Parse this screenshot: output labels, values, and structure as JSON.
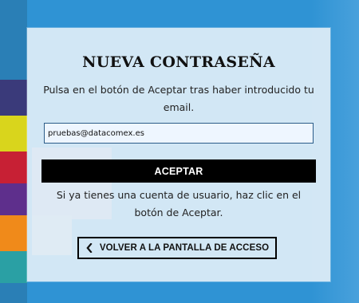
{
  "background": {
    "primary_color": "#2f93d4",
    "color_blocks": [
      {
        "color": "#3a3a7a"
      },
      {
        "color": "#d9d51c"
      },
      {
        "color": "#c72034"
      },
      {
        "color": "#5e2f8c"
      },
      {
        "color": "#f08a1a"
      },
      {
        "color": "#2aa0a4"
      },
      {
        "color": "#e7b3c3"
      },
      {
        "color": "#f2d7cc"
      }
    ]
  },
  "form": {
    "title": "NUEVA CONTRASEÑA",
    "instructions": "Pulsa en el botón de Aceptar tras haber introducido tu email.",
    "email_value": "pruebas@datacomex.es",
    "accept_label": "ACEPTAR",
    "info_text": "Si ya tienes una cuenta de usuario, haz clic en el botón de Aceptar.",
    "back_label": "VOLVER A LA PANTALLA DE ACCESO",
    "back_icon": "chevron-left-icon"
  },
  "colors": {
    "card_bg": "#ddecf7",
    "button_bg": "#000000",
    "button_text": "#ffffff",
    "input_border": "#2b5c88"
  }
}
